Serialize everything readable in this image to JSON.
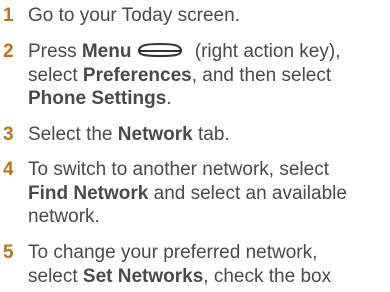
{
  "steps": [
    {
      "number": "1",
      "segments": [
        "Go to your Today screen."
      ]
    },
    {
      "number": "2",
      "segments": [
        "Press ",
        "Menu",
        " (right action key),",
        "select ",
        "Preferences",
        ", and then select",
        "Phone Settings",
        "."
      ]
    },
    {
      "number": "3",
      "segments": [
        "Select the ",
        "Network",
        " tab."
      ]
    },
    {
      "number": "4",
      "segments": [
        "To switch to another network, select",
        "Find Network",
        " and select an available",
        "network."
      ]
    },
    {
      "number": "5",
      "segments": [
        "To change your preferred network,",
        "select ",
        "Set Networks",
        ", check the box"
      ]
    }
  ],
  "icons": {
    "menu_key": "menu-key-icon"
  },
  "colors": {
    "step_number": "#c0711c",
    "body_text": "#4a4a4a"
  }
}
